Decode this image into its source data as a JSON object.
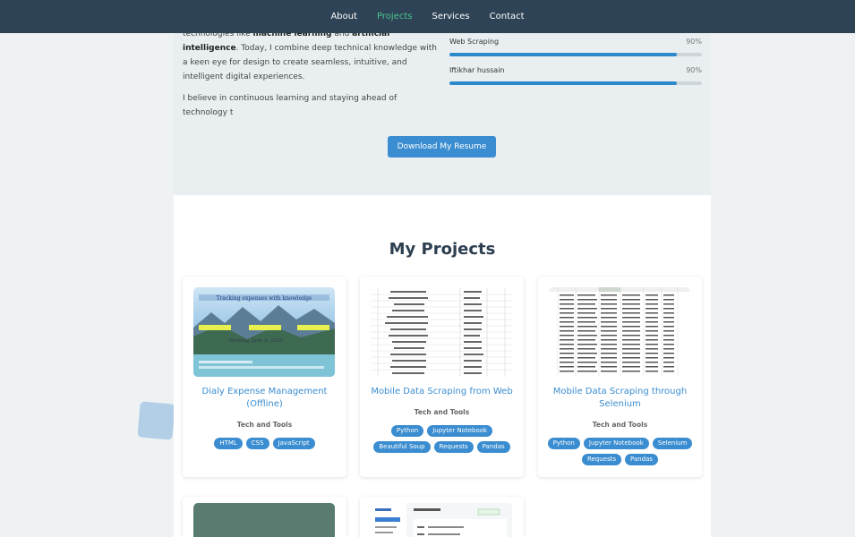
{
  "nav": {
    "items": [
      {
        "label": "About",
        "active": false
      },
      {
        "label": "Projects",
        "active": true
      },
      {
        "label": "Services",
        "active": false
      },
      {
        "label": "Contact",
        "active": false
      }
    ]
  },
  "about": {
    "line1_prefix": "technologies like ",
    "line1_ml": "machine learning",
    "line1_and": " and ",
    "line1_ai": "artificial intelligence",
    "line1_end": ".",
    "paragraph1_rest": "Today, I combine deep technical knowledge with a keen eye for design to create seamless, intuitive, and intelligent digital experiences.",
    "paragraph2": "I believe in continuous learning and staying ahead of technology t",
    "resume_button": "Download My Resume"
  },
  "skills": [
    {
      "label": "Web Scraping",
      "percent_text": "90%",
      "level": 0.9
    },
    {
      "label": "Iftikhar hussain",
      "percent_text": "90%",
      "level": 0.9
    }
  ],
  "projects": {
    "heading": "My Projects",
    "cards": [
      {
        "title": "Dialy Expense Management (Offline)",
        "subtitle": "Tech and Tools",
        "tags": [
          "HTML",
          "CSS",
          "JavaScript"
        ],
        "thumb_banner": "Tracking expenses with knowledge",
        "thumb_date": "Monday, June 9, 2025"
      },
      {
        "title": "Mobile Data Scraping from Web",
        "subtitle": "Tech and Tools",
        "tags": [
          "Python",
          "Jupyter Notebook",
          "Beautiful Soup",
          "Requests",
          "Pandas"
        ]
      },
      {
        "title": "Mobile Data Scraping through Selenium",
        "subtitle": "Tech and Tools",
        "tags": [
          "Python",
          "Jupyter Notebook",
          "Selenium",
          "Requests",
          "Pandas"
        ]
      }
    ]
  },
  "colors": {
    "nav_bg": "#2f4356",
    "nav_active": "#48c78e",
    "accent": "#3a8dd0",
    "heading": "#2c3e50"
  }
}
